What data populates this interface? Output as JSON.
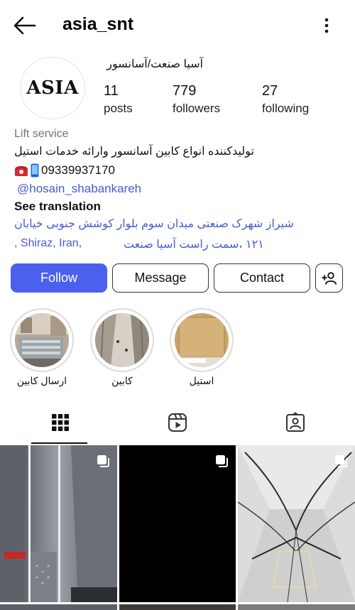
{
  "header": {
    "username": "asia_snt",
    "back_icon": "arrow-left-icon",
    "menu_icon": "more-vertical-icon"
  },
  "profile": {
    "avatar_text": "ASIA",
    "display_name": "آسیا صنعت/آسانسور",
    "stats": [
      {
        "value": "11",
        "label": "posts"
      },
      {
        "value": "779",
        "label": "followers"
      },
      {
        "value": "27",
        "label": "following"
      }
    ],
    "category": "Lift service",
    "bio_line": "تولیدکننده انواع کابین آسانسور وارائه خدمات استیل",
    "phone": "09339937170",
    "phone_icons": [
      "telephone-icon",
      "mobile-phone-icon"
    ],
    "mention": "@hosain_shabankareh",
    "see_translation": "See translation",
    "address_line1": "شیراز شهرک صنعتی میدان سوم بلوار کوشش جنوبی خیابان",
    "address_line2_city": ", Shiraz, Iran,",
    "address_line2_street": "۱۲۱ ،سمت راست آسیا صنعت"
  },
  "actions": {
    "follow": "Follow",
    "message": "Message",
    "contact": "Contact",
    "add_user_icon": "add-person-icon"
  },
  "highlights": [
    {
      "label": "ارسال کابین"
    },
    {
      "label": "کابین"
    },
    {
      "label": "استیل"
    }
  ],
  "tabs": [
    {
      "icon": "grid-icon",
      "active": true
    },
    {
      "icon": "reels-icon",
      "active": false
    },
    {
      "icon": "tagged-icon",
      "active": false
    }
  ],
  "colors": {
    "accent": "#4c60f0",
    "link": "#4a5bd1",
    "muted": "#737373"
  }
}
